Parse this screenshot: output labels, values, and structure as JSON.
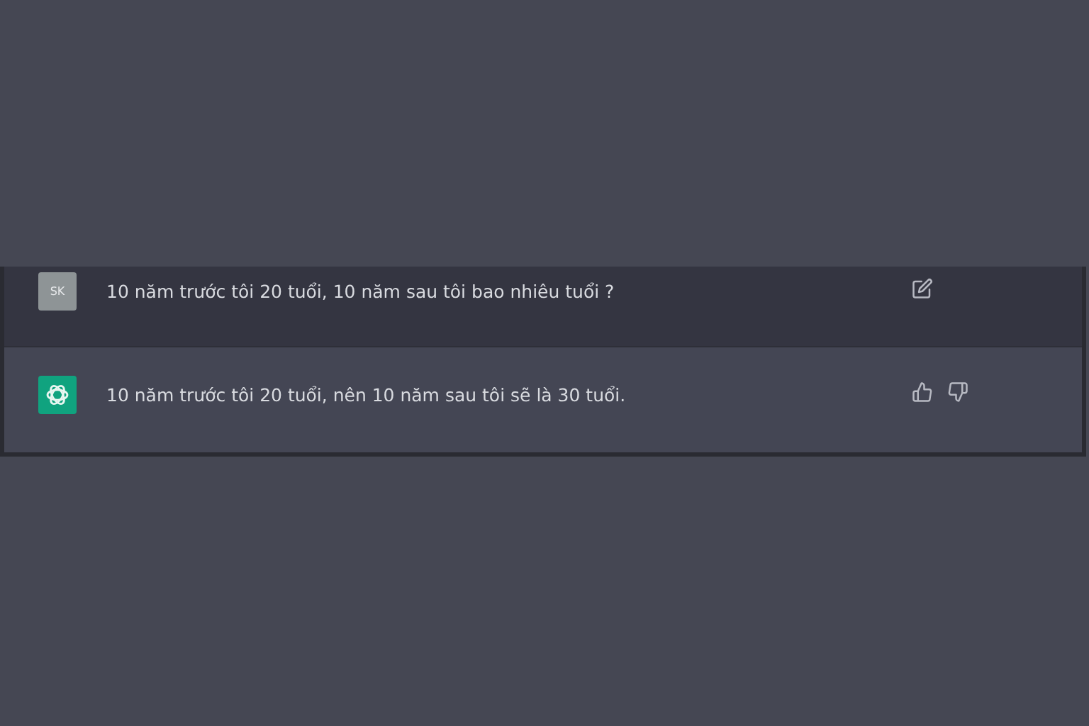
{
  "messages": [
    {
      "kind": "user",
      "avatar": "SK",
      "text": "10 năm trước tôi 20 tuổi, 10 năm sau tôi bao nhiêu tuổi ?"
    },
    {
      "kind": "assistant",
      "text": "10 năm trước tôi 20 tuổi, nên 10 năm sau tôi sẽ là 30 tuổi."
    }
  ]
}
